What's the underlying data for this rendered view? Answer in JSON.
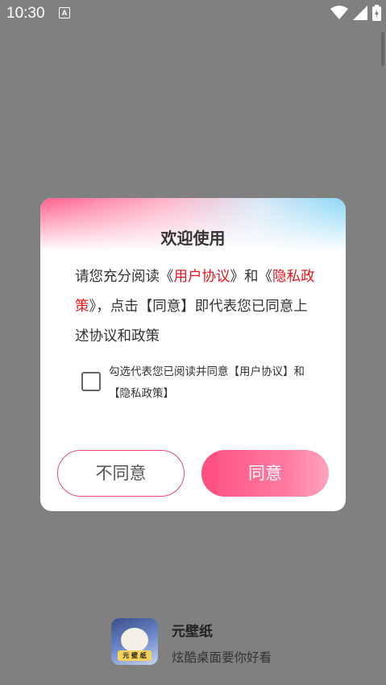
{
  "status_bar": {
    "time": "10:30",
    "notification_badge": "A",
    "icons": [
      "wifi-icon",
      "signal-icon",
      "battery-charging-icon"
    ]
  },
  "dialog": {
    "title": "欢迎使用",
    "body": {
      "part1": "请您充分阅读《",
      "user_agreement": "用户协议",
      "part2": "》和《",
      "privacy_policy": "隐私政策",
      "part3": "》，点击【同意】即代表您已同意上述协议和政策"
    },
    "consent_text": "勾选代表您已阅读并同意【用户协议】和【隐私政策】",
    "consent_checked": false,
    "disagree_label": "不同意",
    "agree_label": "同意"
  },
  "brand": {
    "name": "元壁纸",
    "slogan": "炫酷桌面要你好看",
    "logo_text": "元 壁 纸"
  },
  "colors": {
    "overlay": "#808080",
    "accent_pink": "#ff4d7d",
    "link_red": "#e8161f"
  }
}
